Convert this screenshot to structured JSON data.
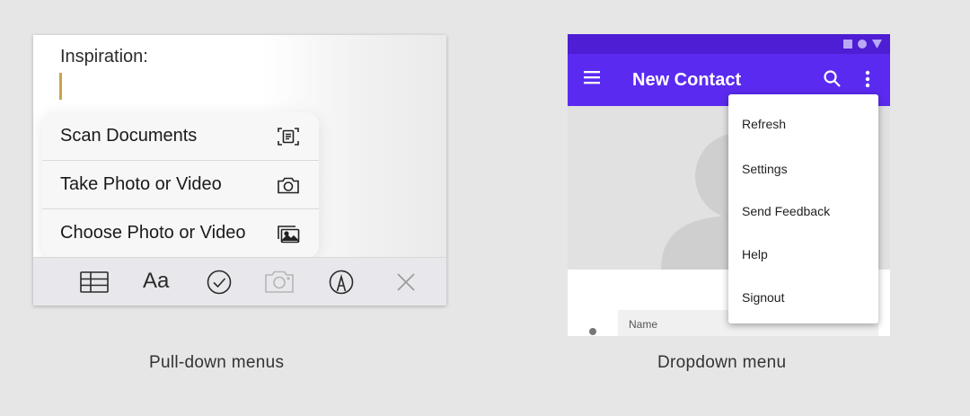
{
  "pulldown_demo": {
    "heading": "Inspiration:",
    "menu_items": [
      {
        "label": "Scan Documents",
        "icon": "scan-document-icon"
      },
      {
        "label": "Take Photo or Video",
        "icon": "camera-icon"
      },
      {
        "label": "Choose Photo or Video",
        "icon": "photo-library-icon"
      }
    ],
    "toolbar": {
      "format_label": "Aa",
      "icons": [
        "table-icon",
        "text-format-icon",
        "checklist-icon",
        "camera-icon",
        "markup-pen-icon",
        "close-icon"
      ]
    },
    "caption": "Pull-down menus",
    "caret_color": "#c9a34a"
  },
  "dropdown_demo": {
    "app_bar": {
      "title": "New Contact",
      "icons": [
        "hamburger-menu-icon",
        "search-icon",
        "more-vert-icon"
      ],
      "color": "#5b2af0",
      "status_bar_color": "#4d1ed3"
    },
    "menu_items": [
      "Refresh",
      "Settings",
      "Send Feedback",
      "Help",
      "Signout"
    ],
    "form": {
      "name_label": "Name"
    },
    "caption": "Dropdown menu"
  }
}
